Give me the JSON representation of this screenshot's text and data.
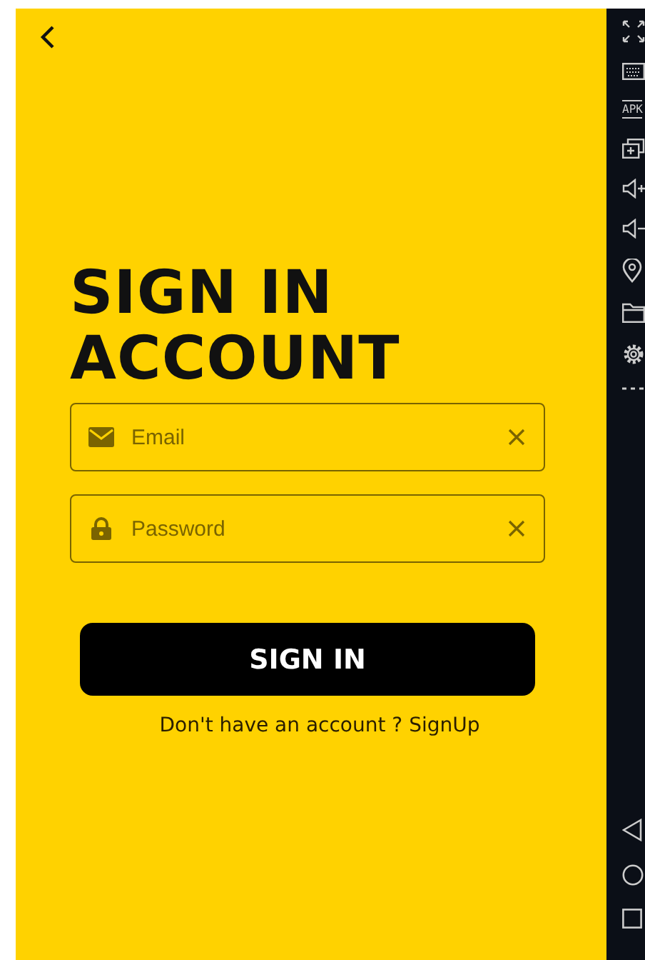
{
  "title_lines": [
    "SIGN IN",
    "ACCOUNT"
  ],
  "fields": [
    {
      "kind": "email",
      "placeholder": "Email"
    },
    {
      "kind": "password",
      "placeholder": "Password"
    }
  ],
  "submit": "SIGN IN",
  "signup_prompt": "Don't have an account ? SignUp",
  "emulator_toolbar": [
    {
      "kind": "fullscreen"
    },
    {
      "kind": "keyboard"
    },
    {
      "kind": "apk",
      "label": "APK"
    },
    {
      "kind": "add-window"
    },
    {
      "kind": "volume-up"
    },
    {
      "kind": "volume-down"
    },
    {
      "kind": "location"
    },
    {
      "kind": "folder"
    },
    {
      "kind": "settings"
    },
    {
      "kind": "more"
    }
  ],
  "nav_buttons": [
    {
      "kind": "back"
    },
    {
      "kind": "home"
    },
    {
      "kind": "recents"
    }
  ]
}
